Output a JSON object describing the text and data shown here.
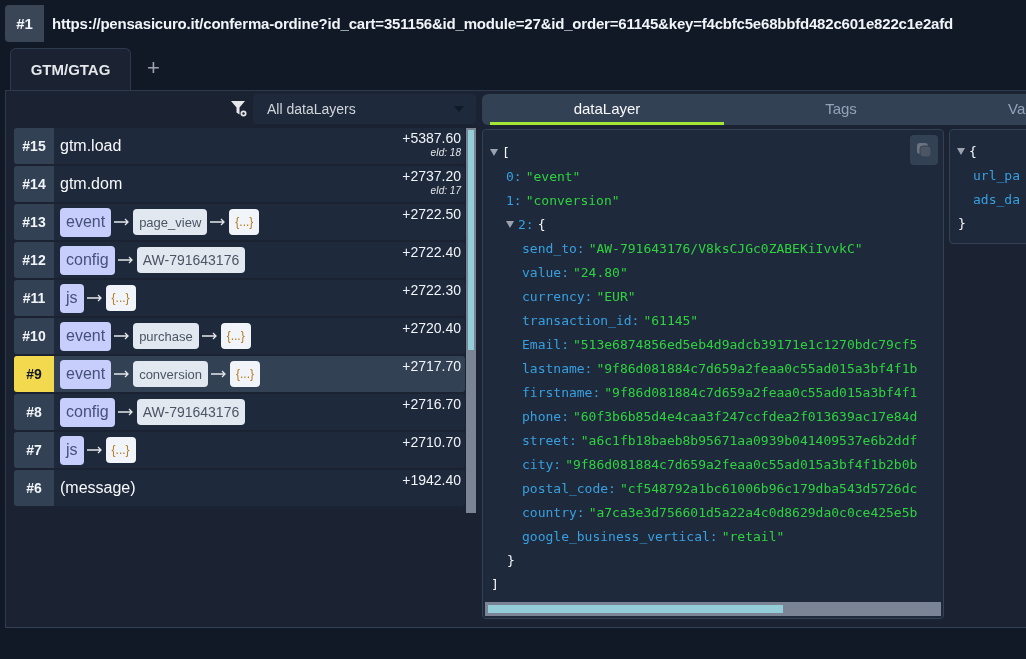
{
  "page_badge": "#1",
  "url": "https://pensasicuro.it/conferma-ordine?id_cart=351156&id_module=27&id_order=61145&key=f4cbfc5e68bbfd482c601e822c1e2afd",
  "container_tabs": [
    {
      "label": "GTM/GTAG",
      "selected": true
    }
  ],
  "add_tab": "+",
  "filter": {
    "value": "All dataLayers"
  },
  "events": [
    {
      "number": "#15",
      "selected": false,
      "kind": "plain",
      "name": "gtm.load",
      "time": "+5387.60",
      "eid": "eId: 18"
    },
    {
      "number": "#14",
      "selected": false,
      "kind": "plain",
      "name": "gtm.dom",
      "time": "+2737.20",
      "eid": "eId: 17"
    },
    {
      "number": "#13",
      "selected": false,
      "kind": "chain",
      "chips": [
        {
          "kind": "command",
          "text": "event"
        },
        {
          "kind": "value",
          "text": "page_view"
        },
        {
          "kind": "object",
          "text": "{...}"
        }
      ],
      "time": "+2722.50"
    },
    {
      "number": "#12",
      "selected": false,
      "kind": "chain",
      "chips": [
        {
          "kind": "command",
          "text": "config"
        },
        {
          "kind": "id",
          "text": "AW-791643176"
        }
      ],
      "time": "+2722.40"
    },
    {
      "number": "#11",
      "selected": false,
      "kind": "chain",
      "chips": [
        {
          "kind": "command",
          "text": "js"
        },
        {
          "kind": "object",
          "text": "{...}"
        }
      ],
      "time": "+2722.30"
    },
    {
      "number": "#10",
      "selected": false,
      "kind": "chain",
      "chips": [
        {
          "kind": "command",
          "text": "event"
        },
        {
          "kind": "value",
          "text": "purchase"
        },
        {
          "kind": "object",
          "text": "{...}"
        }
      ],
      "time": "+2720.40"
    },
    {
      "number": "#9",
      "selected": true,
      "kind": "chain",
      "chips": [
        {
          "kind": "command",
          "text": "event"
        },
        {
          "kind": "value",
          "text": "conversion"
        },
        {
          "kind": "object",
          "text": "{...}"
        }
      ],
      "time": "+2717.70"
    },
    {
      "number": "#8",
      "selected": false,
      "kind": "chain",
      "chips": [
        {
          "kind": "command",
          "text": "config"
        },
        {
          "kind": "id",
          "text": "AW-791643176"
        }
      ],
      "time": "+2716.70"
    },
    {
      "number": "#7",
      "selected": false,
      "kind": "chain",
      "chips": [
        {
          "kind": "command",
          "text": "js"
        },
        {
          "kind": "object",
          "text": "{...}"
        }
      ],
      "time": "+2710.70"
    },
    {
      "number": "#6",
      "selected": false,
      "kind": "plain",
      "name": "(message)",
      "time": "+1942.40"
    }
  ],
  "detail_tabs": [
    {
      "label": "dataLayer",
      "selected": true
    },
    {
      "label": "Tags",
      "selected": false
    },
    {
      "label": "Va",
      "selected": false
    }
  ],
  "json_tree": {
    "open": "[",
    "expanded": true,
    "children": [
      {
        "key": "0:",
        "value": "\"event\""
      },
      {
        "key": "1:",
        "value": "\"conversion\""
      },
      {
        "key": "2:",
        "open": "{",
        "expanded": true,
        "children": [
          {
            "key": "send_to:",
            "value": "\"AW-791643176/V8ksCJGc0ZABEKiIvvkC\""
          },
          {
            "key": "value:",
            "value": "\"24.80\""
          },
          {
            "key": "currency:",
            "value": "\"EUR\""
          },
          {
            "key": "transaction_id:",
            "value": "\"61145\""
          },
          {
            "key": "Email:",
            "value": "\"513e6874856ed5eb4d9adcb39171e1c1270bdc79cf5"
          },
          {
            "key": "lastname:",
            "value": "\"9f86d081884c7d659a2feaa0c55ad015a3bf4f1b"
          },
          {
            "key": "firstname:",
            "value": "\"9f86d081884c7d659a2feaa0c55ad015a3bf4f1"
          },
          {
            "key": "phone:",
            "value": "\"60f3b6b85d4e4caa3f247ccfdea2f013639ac17e84d"
          },
          {
            "key": "street:",
            "value": "\"a6c1fb18baeb8b95671aa0939b041409537e6b2ddf"
          },
          {
            "key": "city:",
            "value": "\"9f86d081884c7d659a2feaa0c55ad015a3bf4f1b2b0b"
          },
          {
            "key": "postal_code:",
            "value": "\"cf548792a1bc61006b96c179dba543d5726dc"
          },
          {
            "key": "country:",
            "value": "\"a7ca3e3d756601d5a22a4c0d8629da0c0ce425e5b"
          },
          {
            "key": "google_business_vertical:",
            "value": "\"retail\""
          }
        ],
        "close": "}"
      }
    ],
    "close": "]"
  },
  "side_tree": {
    "open": "{",
    "expanded": true,
    "children": [
      {
        "key": "url_pa"
      },
      {
        "key": "ads_da"
      }
    ],
    "close": "}"
  }
}
